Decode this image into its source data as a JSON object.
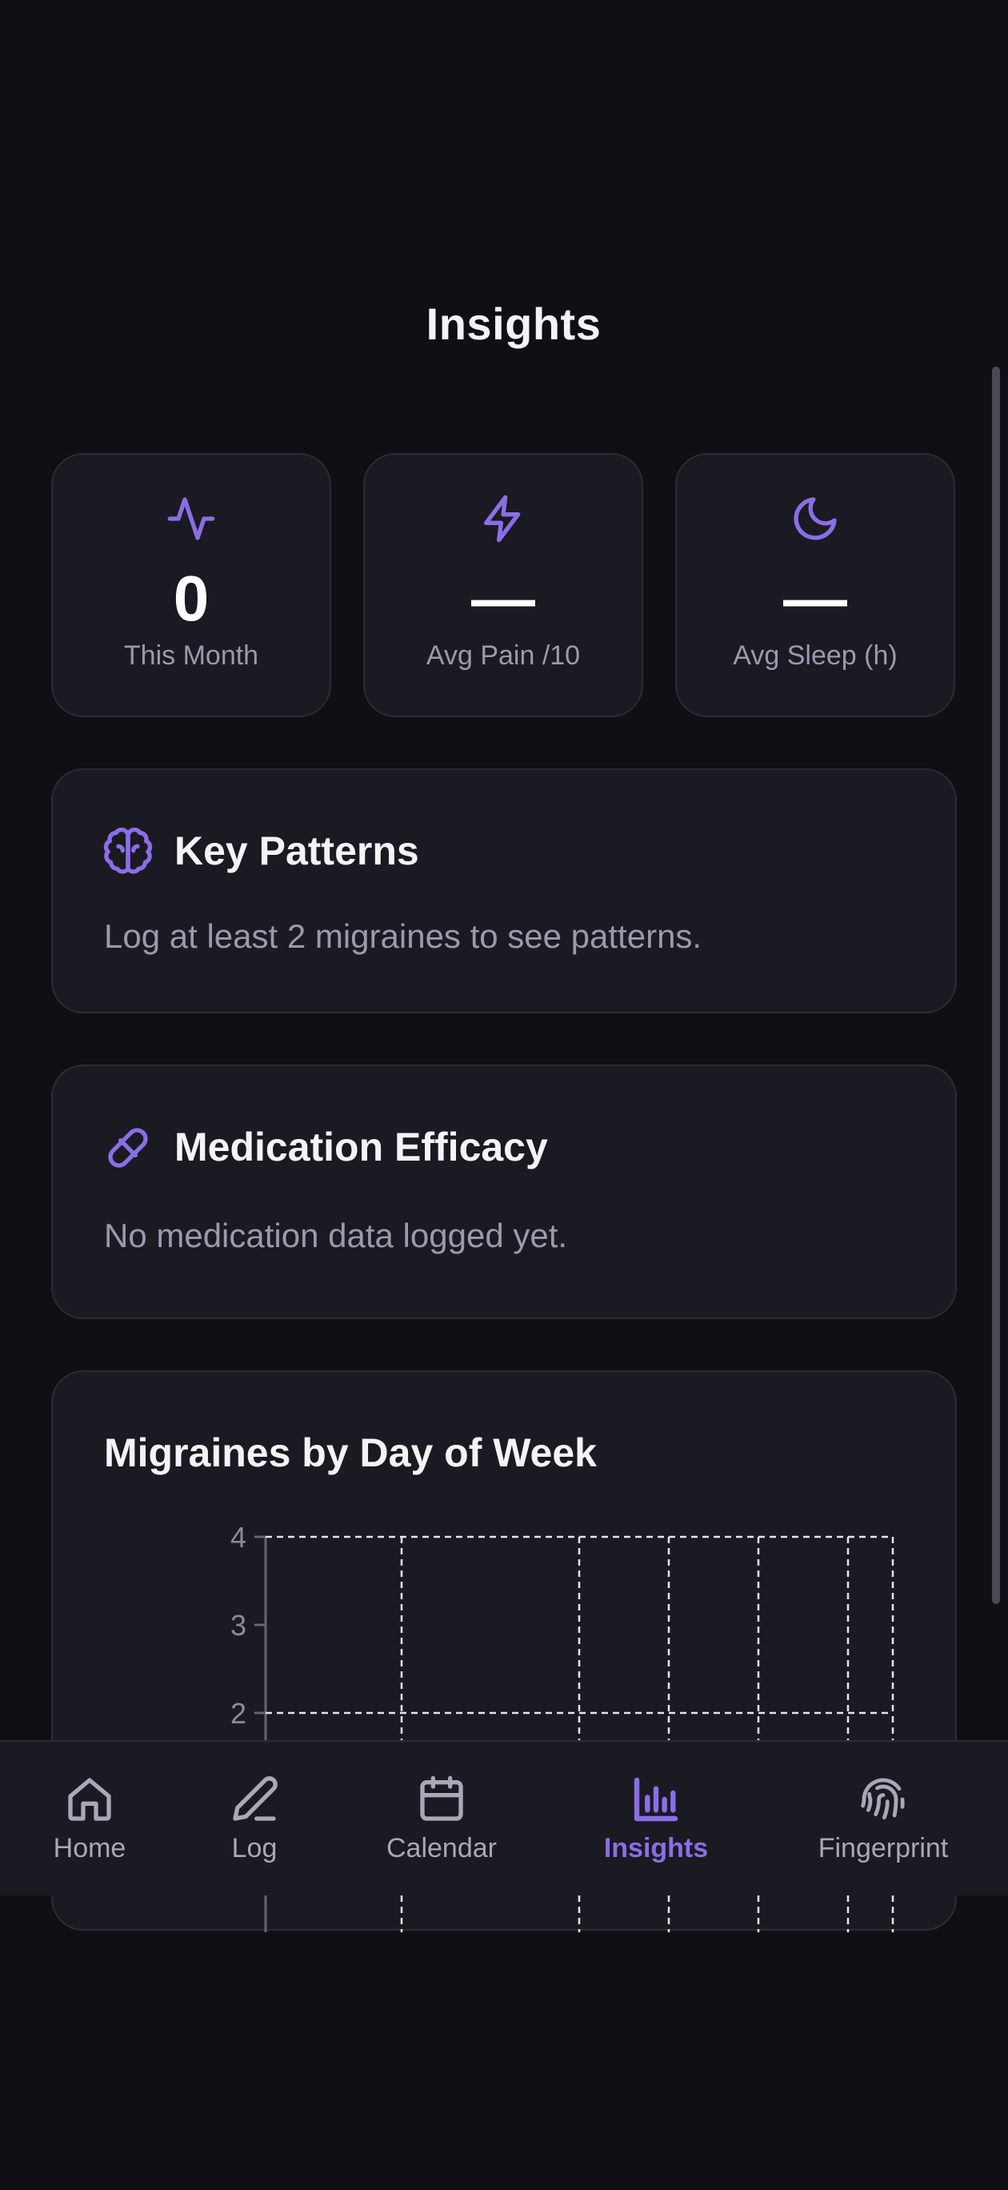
{
  "header": {
    "title": "Insights"
  },
  "stats": [
    {
      "value": "0",
      "label": "This Month",
      "icon": "activity-icon"
    },
    {
      "value": "—",
      "label": "Avg Pain /10",
      "icon": "lightning-icon"
    },
    {
      "value": "—",
      "label": "Avg Sleep (h)",
      "icon": "moon-icon"
    }
  ],
  "key_patterns": {
    "title": "Key Patterns",
    "message": "Log at least 2 migraines to see patterns.",
    "icon": "brain-icon"
  },
  "medication": {
    "title": "Medication Efficacy",
    "message": "No medication data logged yet.",
    "icon": "pill-icon"
  },
  "day_chart": {
    "title": "Migraines by Day of Week"
  },
  "chart_data": {
    "type": "bar",
    "title": "Migraines by Day of Week",
    "y_ticks_visible": [
      "4",
      "3",
      "2"
    ],
    "ylim_visible": [
      2,
      4
    ],
    "grid": true,
    "grid_style": "dashed",
    "values": []
  },
  "nav": {
    "items": [
      {
        "label": "Home",
        "icon": "home-icon",
        "active": false
      },
      {
        "label": "Log",
        "icon": "pencil-icon",
        "active": false
      },
      {
        "label": "Calendar",
        "icon": "calendar-icon",
        "active": false
      },
      {
        "label": "Insights",
        "icon": "bar-chart-icon",
        "active": true
      },
      {
        "label": "Fingerprint",
        "icon": "fingerprint-icon",
        "active": false
      }
    ]
  },
  "colors": {
    "background": "#0f0f14",
    "card": "#1a1a22",
    "border": "#2c2c36",
    "accent": "#8b6ee6",
    "muted_text": "#9a9aad"
  }
}
